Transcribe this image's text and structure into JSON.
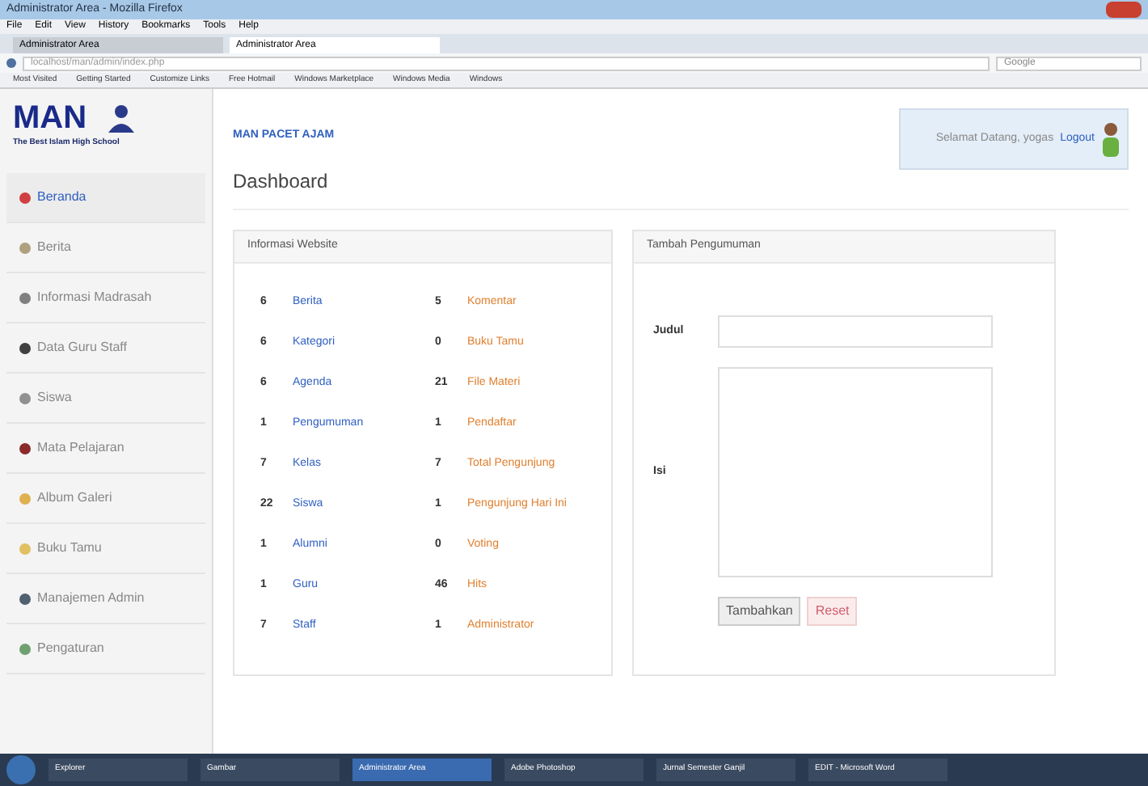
{
  "window": {
    "title": "Administrator Area - Mozilla Firefox"
  },
  "menu": [
    "File",
    "Edit",
    "View",
    "History",
    "Bookmarks",
    "Tools",
    "Help"
  ],
  "tabs": [
    {
      "label": "Administrator Area",
      "selected": false
    },
    {
      "label": "Administrator Area",
      "selected": true
    }
  ],
  "address": "localhost/man/admin/index.php",
  "search": {
    "placeholder": "Google"
  },
  "bookmarks": [
    "Most Visited",
    "Getting Started",
    "Customize Links",
    "Free Hotmail",
    "Windows Marketplace",
    "Windows Media",
    "Windows"
  ],
  "logo": {
    "title": "MAN",
    "subtitle": "The Best Islam High School"
  },
  "sidebar": {
    "items": [
      {
        "label": "Beranda",
        "selected": true,
        "color": "#d04040"
      },
      {
        "label": "Berita",
        "selected": false,
        "color": "#b0a080"
      },
      {
        "label": "Informasi Madrasah",
        "selected": false,
        "color": "#808080"
      },
      {
        "label": "Data Guru Staff",
        "selected": false,
        "color": "#404040"
      },
      {
        "label": "Siswa",
        "selected": false,
        "color": "#909090"
      },
      {
        "label": "Mata Pelajaran",
        "selected": false,
        "color": "#8a2a2a"
      },
      {
        "label": "Album Galeri",
        "selected": false,
        "color": "#e0b050"
      },
      {
        "label": "Buku Tamu",
        "selected": false,
        "color": "#e0c060"
      },
      {
        "label": "Manajemen Admin",
        "selected": false,
        "color": "#506070"
      },
      {
        "label": "Pengaturan",
        "selected": false,
        "color": "#70a070"
      }
    ]
  },
  "header": {
    "link": "MAN PACET AJAM",
    "welcome": "Selamat Datang, yogas",
    "logout": "Logout"
  },
  "page_title": "Dashboard",
  "info_panel": {
    "title": "Informasi Website",
    "rows": [
      {
        "count_1": "6",
        "label_1": "Berita",
        "count_2": "5",
        "label_2": "Komentar"
      },
      {
        "count_1": "6",
        "label_1": "Kategori",
        "count_2": "0",
        "label_2": "Buku Tamu"
      },
      {
        "count_1": "6",
        "label_1": "Agenda",
        "count_2": "21",
        "label_2": "File Materi"
      },
      {
        "count_1": "1",
        "label_1": "Pengumuman",
        "count_2": "1",
        "label_2": "Pendaftar"
      },
      {
        "count_1": "7",
        "label_1": "Kelas",
        "count_2": "7",
        "label_2": "Total Pengunjung"
      },
      {
        "count_1": "22",
        "label_1": "Siswa",
        "count_2": "1",
        "label_2": "Pengunjung Hari Ini"
      },
      {
        "count_1": "1",
        "label_1": "Alumni",
        "count_2": "0",
        "label_2": "Voting"
      },
      {
        "count_1": "1",
        "label_1": "Guru",
        "count_2": "46",
        "label_2": "Hits"
      },
      {
        "count_1": "7",
        "label_1": "Staff",
        "count_2": "1",
        "label_2": "Administrator"
      }
    ]
  },
  "form_panel": {
    "title": "Tambah Pengumuman",
    "fields": [
      {
        "label": "Judul",
        "kind": "input"
      },
      {
        "label": "Isi",
        "kind": "textarea"
      }
    ],
    "buttons": [
      {
        "label": "Tambahkan",
        "kind": "submit"
      },
      {
        "label": "Reset",
        "kind": "reset"
      }
    ]
  },
  "taskbar": {
    "items": [
      {
        "label": "Explorer",
        "selected": false
      },
      {
        "label": "Gambar",
        "selected": false
      },
      {
        "label": "Administrator Area",
        "selected": true
      },
      {
        "label": "Adobe Photoshop",
        "selected": false
      },
      {
        "label": "Jurnal Semester Ganjil",
        "selected": false
      },
      {
        "label": "EDIT - Microsoft Word",
        "selected": false
      }
    ]
  }
}
